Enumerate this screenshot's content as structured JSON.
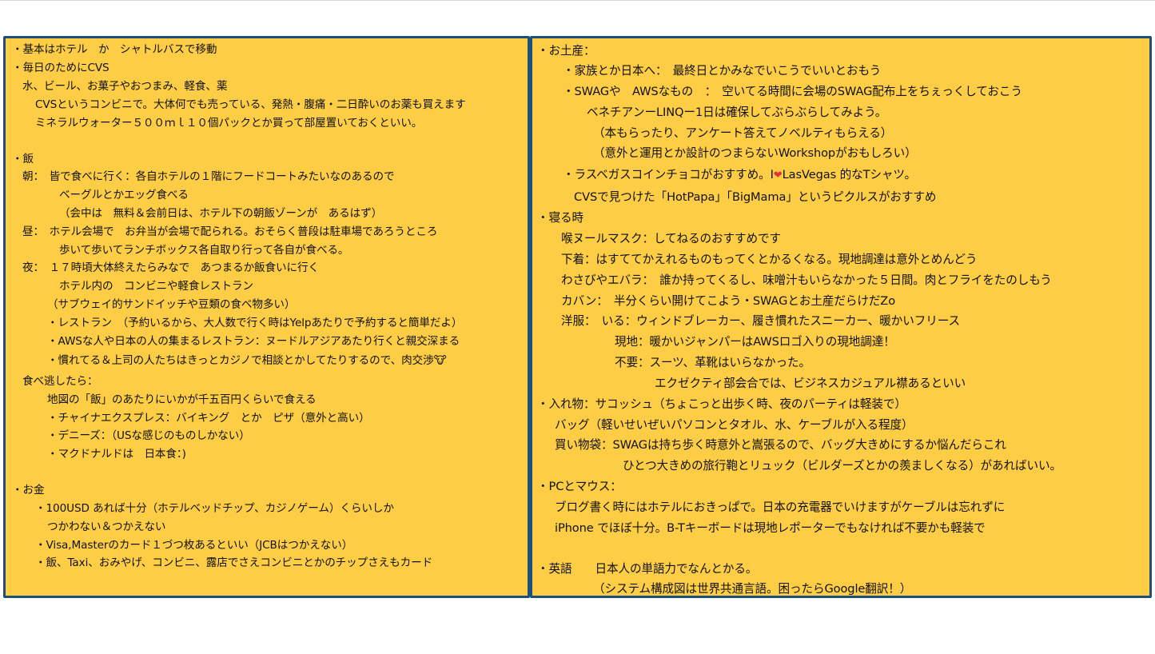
{
  "left_panel": {
    "lines": [
      "・基本はホテル　か　シャトルバスで移動",
      "・毎日のためにCVS",
      "水、ビール、お菓子やおつまみ、軽食、薬",
      "CVSというコンビニで。大体何でも売っている、発熱・腹痛・二日酔いのお薬も買えます",
      "ミネラルウォーター５００ｍｌ１０個パックとか買って部屋置いておくといい。",
      "・飯",
      "朝：　皆で食べに行く：各自ホテルの１階にフードコートみたいなのあるので",
      "ベーグルとかエッグ食べる",
      "（会中は　無料＆会前日は、ホテル下の朝飯ゾーンが　あるはず）",
      "昼：　ホテル会場で　お弁当が会場で配られる。おそらく普段は駐車場であろうところ",
      "歩いて歩いてランチボックス各自取り行って各自が食べる。",
      "夜：　１７時頃大体終えたらみなで　あつまるか飯食いに行く",
      "ホテル内の　コンビニや軽食レストラン",
      "（サブウェイ的サンドイッチや豆類の食べ物多い）",
      "・レストラン　（予約いるから、大人数で行く時はYelpあたりで予約すると簡単だよ）",
      "・AWSな人や日本の人の集まるレストラン：ヌードルアジアあたり行くと親交深まる",
      "・慣れてる＆上司の人たちはきっとカジノで相談とかしてたりするので、肉交渉🐮",
      "食べ逃したら：",
      "地図の「飯」のあたりにいかが千五百円くらいで食える",
      "・チャイナエクスプレス：バイキング　とか　ピザ（意外と高い）",
      "・デニーズ：（USな感じのものしかない）",
      "・マクドナルドは　日本食：)",
      "・お金",
      "・100USD あれば十分（ホテルベッドチップ、カジノゲーム）くらいしか",
      "つかわない＆つかえない",
      "・Visa,Masterのカード１づつ枚あるといい（JCBはつかえない）",
      "・飯、Taxi、おみやげ、コンビニ、露店でさえコンビニとかのチップさえもカード"
    ]
  },
  "right_panel": {
    "lines": [
      "・お土産：",
      "・家族とか日本へ：　最終日とかみなでいこうでいいとおもう",
      "・SWAGや　AWSなもの　：　空いてる時間に会場のSWAG配布上をちぇっくしておこう",
      "ベネチアンーLINQー1日は確保してぶらぶらしてみよう。",
      "（本もらったり、アンケート答えてノベルティもらえる）",
      "（意外と運用とか設計のつまらないWorkshopがおもしろい）",
      "・ラスベガスコインチョコがおすすめ。I",
      "LasVegas 的なTシャツ。",
      "CVSで見つけた「HotPapa」「BigMama」というピクルスがおすすめ",
      "・寝る時",
      "喉ヌールマスク：してねるのおすすめです",
      "下着：はすててかえれるものもってくとかるくなる。現地調達は意外とめんどう",
      "わさびやエバラ：　誰か持ってくるし、味噌汁もいらなかった５日間。肉とフライをたのしもう",
      "カバン：　半分くらい開けてこよう・SWAGとお土産だらけだZo",
      "洋服：　いる：ウィンドブレーカー、履き慣れたスニーカー、暖かいフリース",
      "現地：暖かいジャンパーはAWSロゴ入りの現地調達！",
      "不要：スーツ、革靴はいらなかった。",
      "エクゼクティ部会合では、ビジネスカジュアル襟あるといい",
      "・入れ物：サコッシュ（ちょこっと出歩く時、夜のパーティは軽装で）",
      "バッグ（軽いせいぜいパソコンとタオル、水、ケーブルが入る程度）",
      "買い物袋：SWAGは持ち歩く時意外と嵩張るので、バッグ大きめにするか悩んだらこれ",
      "ひとつ大きめの旅行鞄とリュック（ビルダーズとかの羨ましくなる）があればいい。",
      "・PCとマウス：",
      "ブログ書く時にはホテルにおきっぱで。日本の充電器でいけますがケーブルは忘れずに",
      "iPhone でほぼ十分。B-Tキーボードは現地レポーターでもなければ不要かも軽装で",
      "・英語　　日本人の単語力でなんとかる。",
      "（システム構成図は世界共通言語。困ったらGoogle翻訳！）"
    ],
    "heart_icon": "❤"
  },
  "colors": {
    "panel_fill": "#FDCD45",
    "panel_border": "#1F4E7A",
    "heart": "#E0303A"
  }
}
